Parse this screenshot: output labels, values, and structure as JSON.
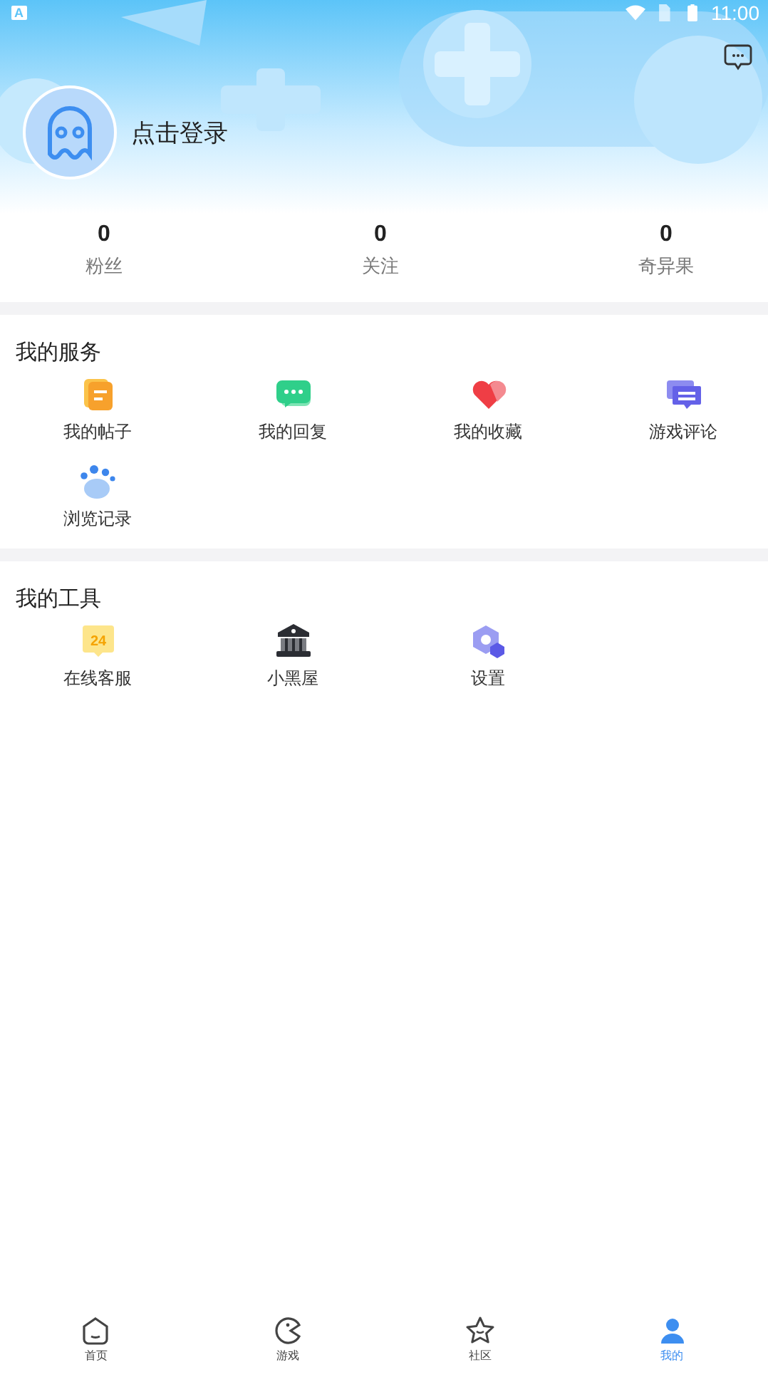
{
  "status_bar": {
    "notification": "A",
    "time": "11:00"
  },
  "profile": {
    "login_text": "点击登录"
  },
  "stats": [
    {
      "value": "0",
      "label": "粉丝"
    },
    {
      "value": "0",
      "label": "关注"
    },
    {
      "value": "0",
      "label": "奇异果"
    }
  ],
  "sections": [
    {
      "title": "我的服务",
      "items": [
        {
          "label": "我的帖子",
          "kind": "posts"
        },
        {
          "label": "我的回复",
          "kind": "replies"
        },
        {
          "label": "我的收藏",
          "kind": "favorites"
        },
        {
          "label": "游戏评论",
          "kind": "reviews"
        },
        {
          "label": "浏览记录",
          "kind": "history"
        }
      ]
    },
    {
      "title": "我的工具",
      "items": [
        {
          "label": "在线客服",
          "kind": "support",
          "icon_text": "24"
        },
        {
          "label": "小黑屋",
          "kind": "blackroom"
        },
        {
          "label": "设置",
          "kind": "settings"
        }
      ]
    }
  ],
  "bottom_nav": [
    {
      "label": "首页",
      "kind": "home",
      "selected": false
    },
    {
      "label": "游戏",
      "kind": "game",
      "selected": false
    },
    {
      "label": "社区",
      "kind": "community",
      "selected": false
    },
    {
      "label": "我的",
      "kind": "me",
      "selected": true
    }
  ]
}
